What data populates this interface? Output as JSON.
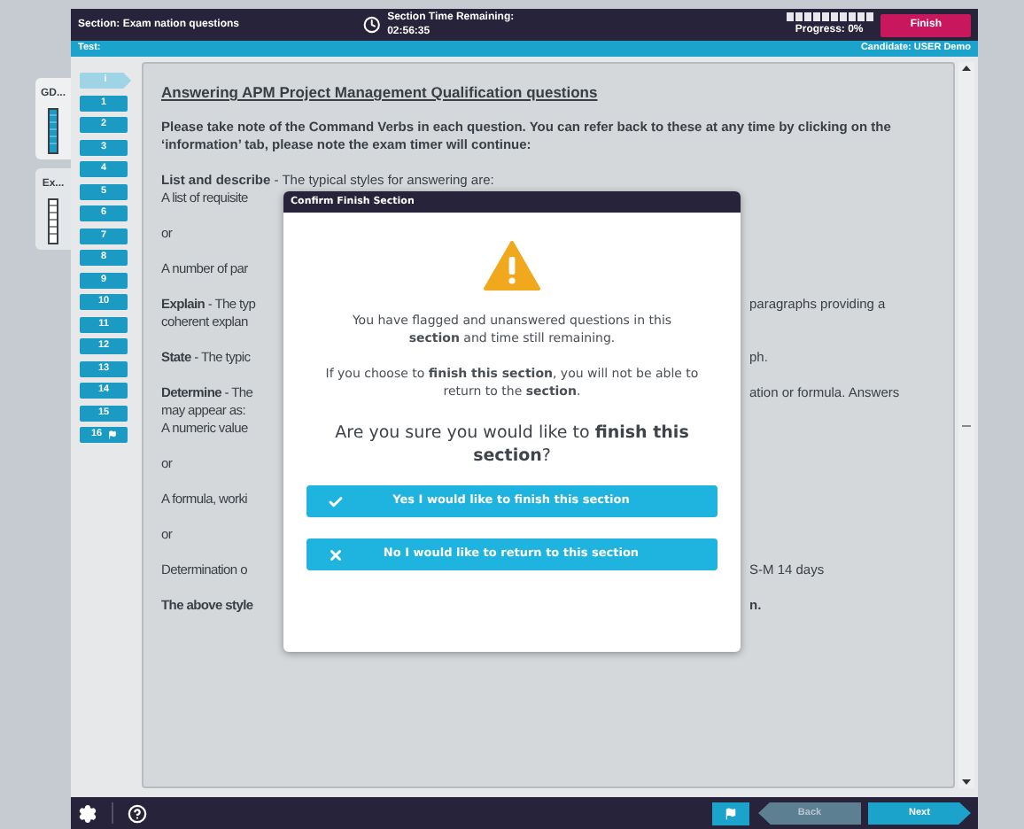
{
  "header": {
    "section": "Section: Exam nation questions",
    "timer_label": "Section Time Remaining:",
    "timer_value": "02:56:35",
    "progress": {
      "level": 0,
      "label": "Progress: 0%"
    },
    "finish_button": "Finish"
  },
  "subbar": {
    "test": "Test:",
    "candidate": "Candidate: USER Demo"
  },
  "side_tabs": [
    {
      "label": "GD...",
      "highlighted": true
    },
    {
      "label": "Ex...",
      "highlighted": false
    }
  ],
  "questions": [
    {
      "label": "i",
      "selected": true,
      "flagged": false
    },
    {
      "label": "1",
      "selected": false,
      "flagged": false
    },
    {
      "label": "2",
      "selected": false,
      "flagged": false
    },
    {
      "label": "3",
      "selected": false,
      "flagged": false
    },
    {
      "label": "4",
      "selected": false,
      "flagged": false
    },
    {
      "label": "5",
      "selected": false,
      "flagged": false
    },
    {
      "label": "6",
      "selected": false,
      "flagged": false
    },
    {
      "label": "7",
      "selected": false,
      "flagged": false
    },
    {
      "label": "8",
      "selected": false,
      "flagged": false
    },
    {
      "label": "9",
      "selected": false,
      "flagged": false
    },
    {
      "label": "10",
      "selected": false,
      "flagged": false
    },
    {
      "label": "11",
      "selected": false,
      "flagged": false
    },
    {
      "label": "12",
      "selected": false,
      "flagged": false
    },
    {
      "label": "13",
      "selected": false,
      "flagged": false
    },
    {
      "label": "14",
      "selected": false,
      "flagged": false
    },
    {
      "label": "15",
      "selected": false,
      "flagged": false
    },
    {
      "label": "16",
      "selected": false,
      "flagged": true
    }
  ],
  "content": [
    {
      "kind": "heading",
      "bold": true,
      "lines": [
        {
          "kind": "full",
          "text": "Answering APM Project Management Qualification questions"
        }
      ]
    },
    {
      "kind": "paragraph",
      "bold": true,
      "lines": [
        {
          "kind": "full",
          "text": "Please take note of the Command Verbs in each question.  You can refer back to these at any time by clicking on the ‘information’ tab, please note the exam timer will continue:"
        }
      ]
    },
    {
      "kind": "paragraph",
      "bold": false,
      "lines": [
        {
          "kind": "full",
          "text": "**List and describe** - The typical styles for answering are:"
        },
        {
          "kind": "split",
          "text": "A list of requisite"
        }
      ]
    },
    {
      "kind": "paragraph",
      "bold": false,
      "lines": [
        {
          "kind": "split",
          "text": "or"
        }
      ]
    },
    {
      "kind": "paragraph",
      "bold": false,
      "lines": [
        {
          "kind": "split",
          "text": "A number of par"
        }
      ]
    },
    {
      "kind": "paragraph",
      "bold": false,
      "lines": [
        {
          "kind": "split",
          "text": "**Explain** - The typ",
          "right": "paragraphs providing a"
        },
        {
          "kind": "split",
          "text": "coherent explan"
        }
      ]
    },
    {
      "kind": "paragraph",
      "bold": false,
      "lines": [
        {
          "kind": "split",
          "text": "**State** - The typic",
          "right": "ph."
        }
      ]
    },
    {
      "kind": "paragraph",
      "bold": false,
      "lines": [
        {
          "kind": "split",
          "text": "**Determine** - The",
          "right": "ation or formula. Answers"
        },
        {
          "kind": "split",
          "text": "may appear as:"
        },
        {
          "kind": "split",
          "text": "A numeric value"
        }
      ]
    },
    {
      "kind": "paragraph",
      "bold": false,
      "lines": [
        {
          "kind": "split",
          "text": "or"
        }
      ]
    },
    {
      "kind": "paragraph",
      "bold": false,
      "lines": [
        {
          "kind": "split",
          "text": "A formula, worki"
        }
      ]
    },
    {
      "kind": "paragraph",
      "bold": false,
      "lines": [
        {
          "kind": "split",
          "text": "or"
        }
      ]
    },
    {
      "kind": "paragraph",
      "bold": false,
      "lines": [
        {
          "kind": "split",
          "text": "Determination o",
          "right": "S-M 14 days"
        }
      ]
    },
    {
      "kind": "paragraph",
      "bold": true,
      "lines": [
        {
          "kind": "split",
          "text": "The above style",
          "right": "n."
        }
      ]
    }
  ],
  "dialog": {
    "title": "Confirm Finish Section",
    "messages": [
      "You have flagged and unanswered questions in this **section** and time still remaining.",
      "If you choose to **finish this section**, you will not be able to return to the **section**."
    ],
    "question": "Are you sure you would like to **finish this section**?",
    "buttons": [
      {
        "kind": "confirm",
        "label": "Yes I would like to finish this section"
      },
      {
        "kind": "cancel",
        "label": "No I would like to return to this section"
      }
    ]
  },
  "footer": {
    "back": {
      "label": "Back",
      "disabled": true
    },
    "next": {
      "label": "Next",
      "disabled": false
    }
  }
}
